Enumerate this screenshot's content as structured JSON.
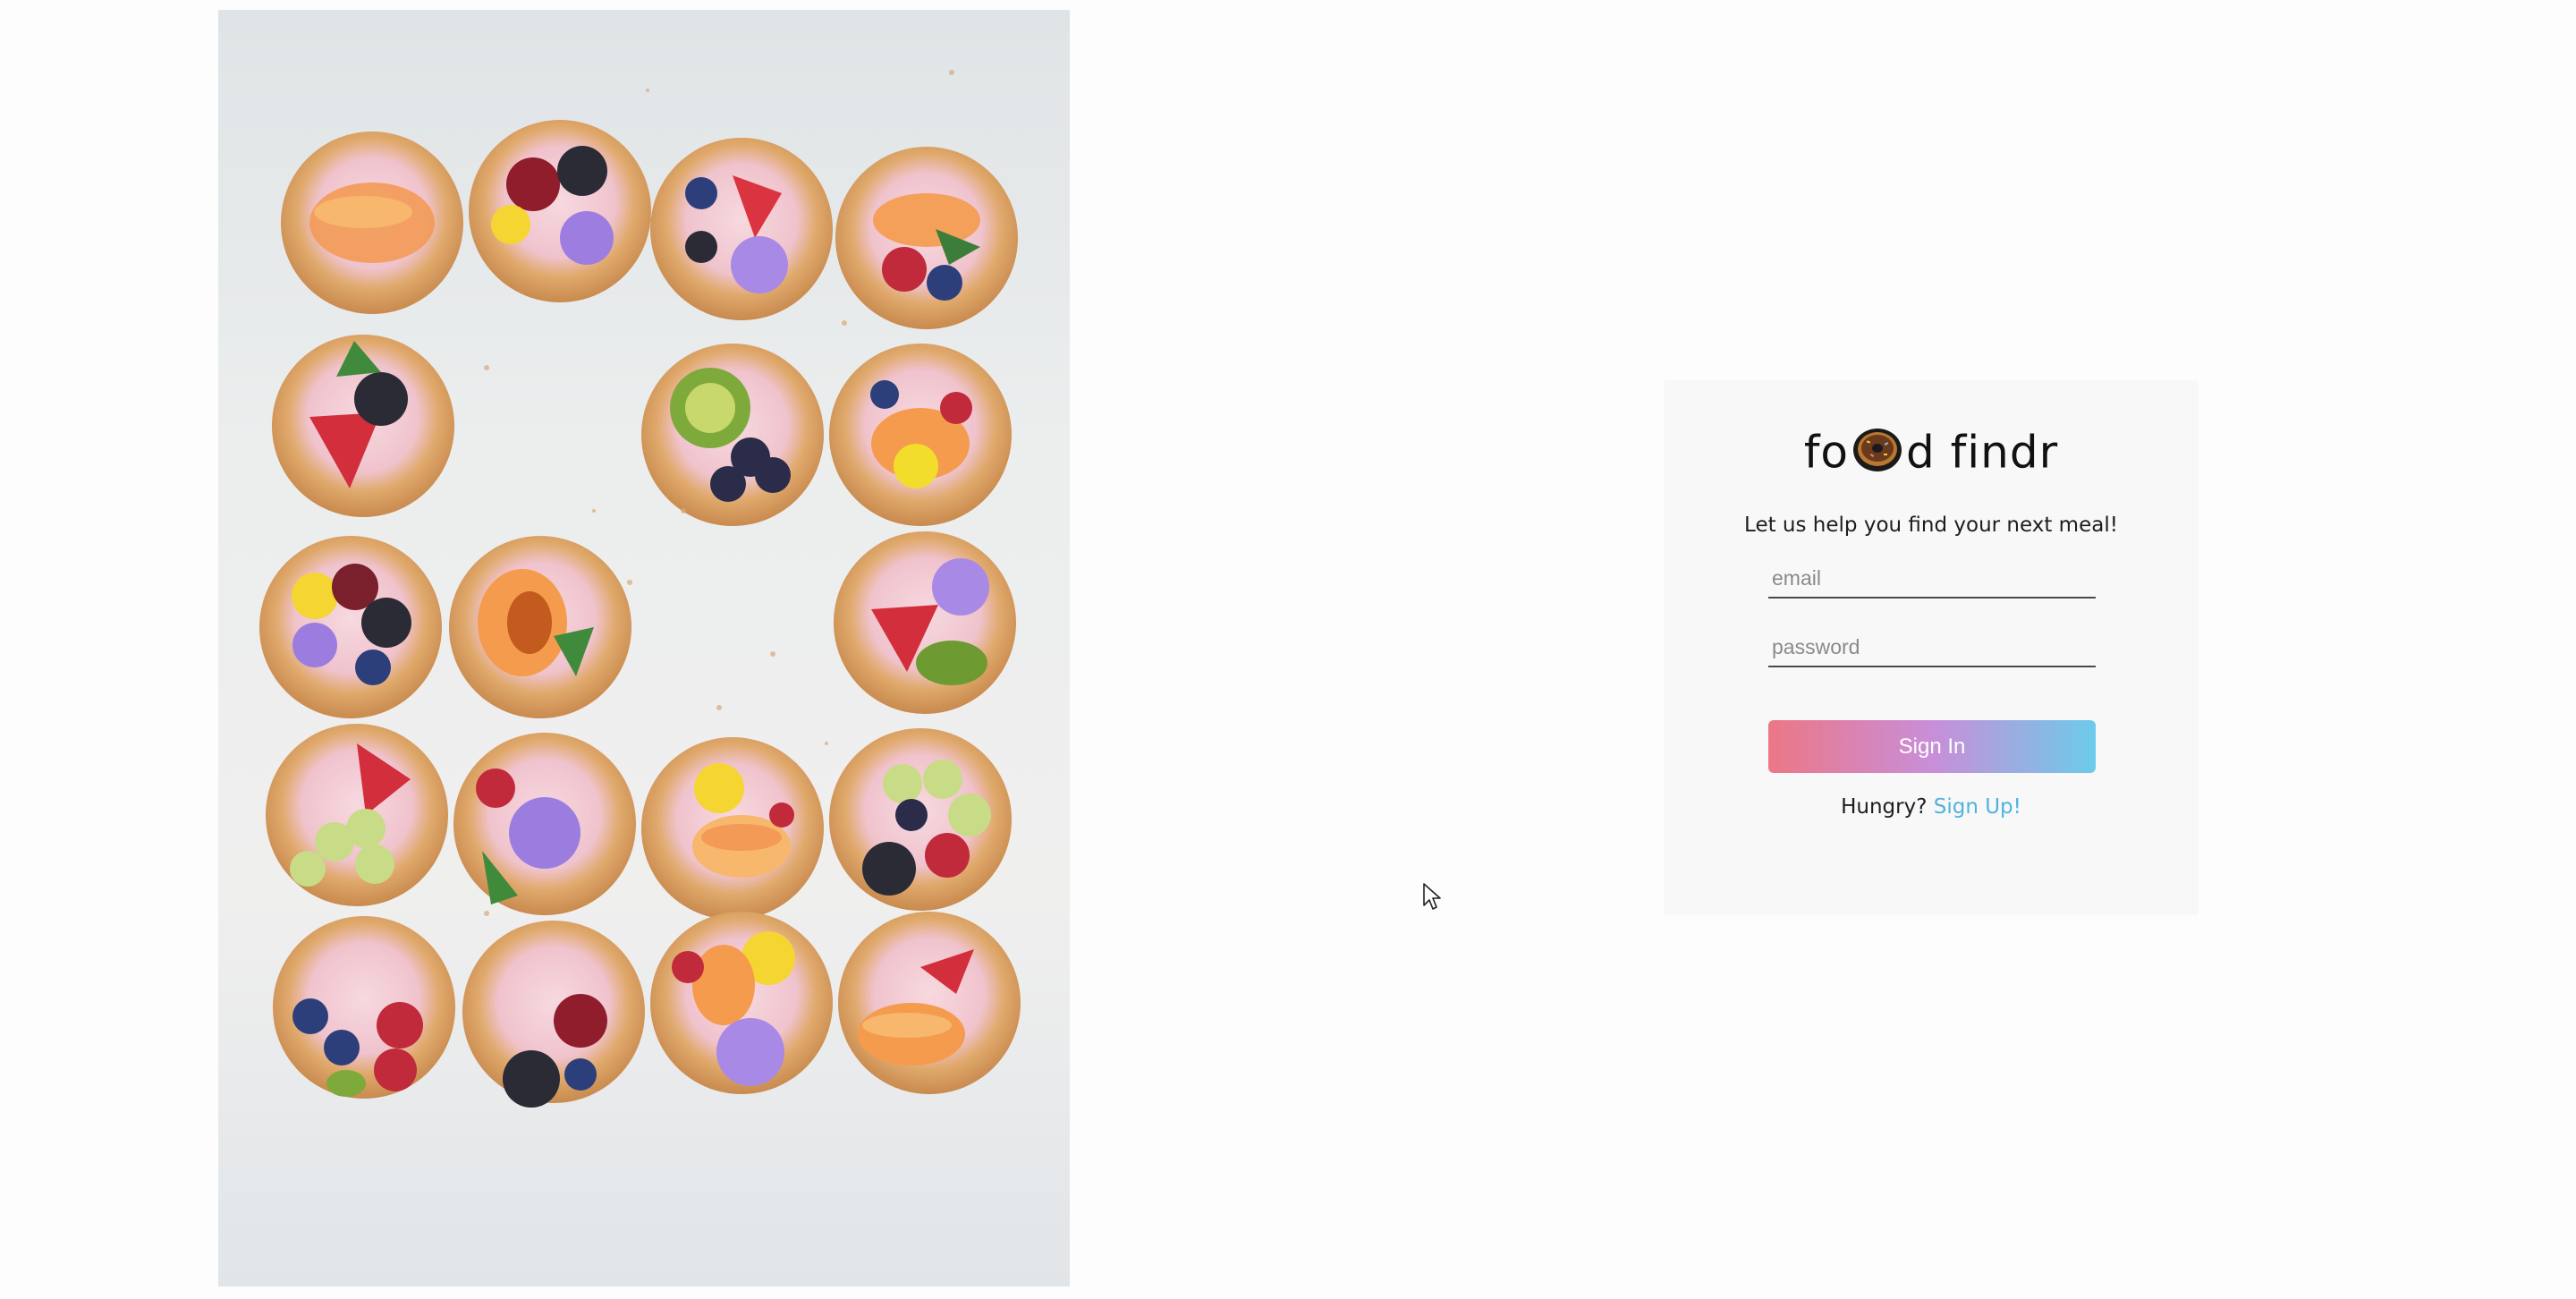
{
  "hero": {
    "alt": "Fruit-topped cream tartlets arranged in a grid"
  },
  "login": {
    "logo_left": "fo",
    "logo_right": "d findr",
    "logo_icon": "donut-icon",
    "tagline": "Let us help you find your next meal!",
    "email_placeholder": "email",
    "email_value": "",
    "password_placeholder": "password",
    "password_value": "",
    "signin_label": "Sign In",
    "signup_prompt": "Hungry?",
    "signup_link": "Sign Up!"
  },
  "colors": {
    "background": "#fdfdfd",
    "card": "#f8f8f9",
    "button_gradient_start": "#ec7786",
    "button_gradient_mid": "#c98ed8",
    "button_gradient_end": "#6ccbea",
    "link": "#4fb3df"
  },
  "cursor_icon": "arrow-pointer-icon"
}
